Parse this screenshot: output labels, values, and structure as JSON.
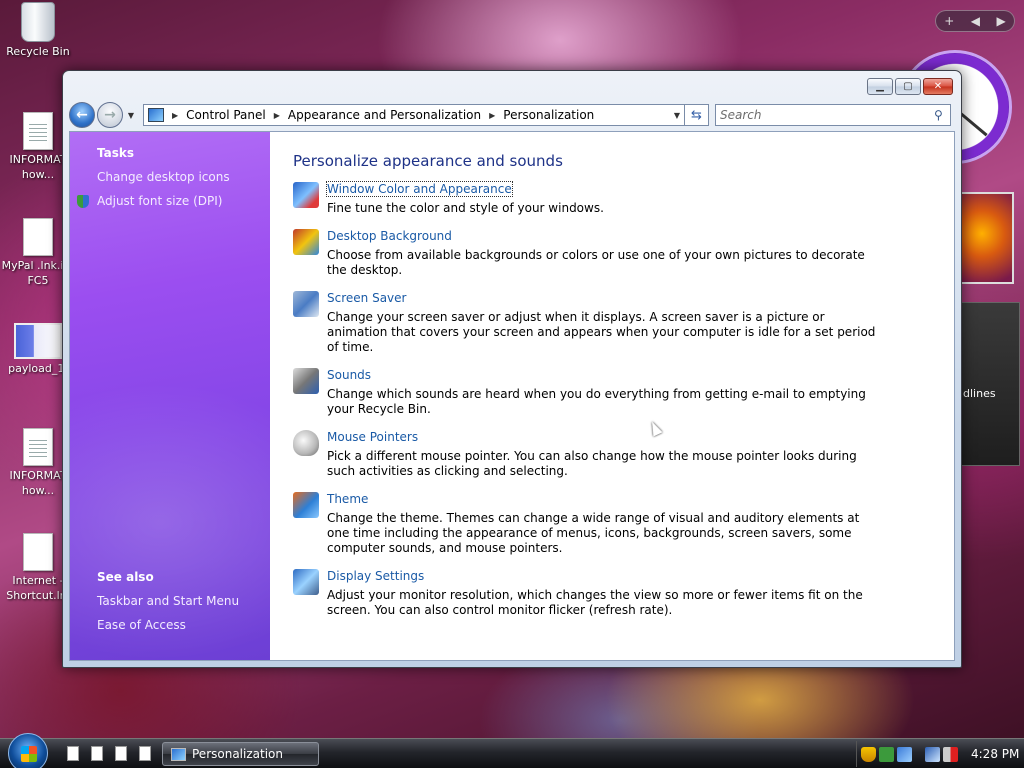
{
  "desktop": {
    "icons": [
      {
        "label": "Recycle Bin"
      },
      {
        "label": "INFORMAT how..."
      },
      {
        "label": "MyPal .lnk.id-FC5"
      },
      {
        "label": "payload_1."
      },
      {
        "label": "INFORMAT how..."
      },
      {
        "label": "Internet - Shortcut.lnl"
      }
    ],
    "gadget_controls": {
      "add": "+",
      "prev": "◀",
      "next": "▶"
    },
    "feed_gadget_text": "dlines"
  },
  "window": {
    "title_buttons": {
      "minimize": "▁",
      "maximize": "▢",
      "close": "✕"
    },
    "breadcrumb": [
      "Control Panel",
      "Appearance and Personalization",
      "Personalization"
    ],
    "search_placeholder": "Search",
    "sidebar": {
      "tasks_heading": "Tasks",
      "tasks": [
        "Change desktop icons",
        "Adjust font size (DPI)"
      ],
      "see_also_heading": "See also",
      "see_also": [
        "Taskbar and Start Menu",
        "Ease of Access"
      ]
    },
    "main": {
      "heading": "Personalize appearance and sounds",
      "items": [
        {
          "icon": "window-color-icon",
          "title": "Window Color and Appearance",
          "desc": "Fine tune the color and style of your windows."
        },
        {
          "icon": "desktop-background-icon",
          "title": "Desktop Background",
          "desc": "Choose from available backgrounds or colors or use one of your own pictures to decorate the desktop."
        },
        {
          "icon": "screen-saver-icon",
          "title": "Screen Saver",
          "desc": "Change your screen saver or adjust when it displays. A screen saver is a picture or animation that covers your screen and appears when your computer is idle for a set period of time."
        },
        {
          "icon": "sounds-icon",
          "title": "Sounds",
          "desc": "Change which sounds are heard when you do everything from getting e-mail to emptying your Recycle Bin."
        },
        {
          "icon": "mouse-pointers-icon",
          "title": "Mouse Pointers",
          "desc": "Pick a different mouse pointer. You can also change how the mouse pointer looks during such activities as clicking and selecting."
        },
        {
          "icon": "theme-icon",
          "title": "Theme",
          "desc": "Change the theme. Themes can change a wide range of visual and auditory elements at one time including the appearance of menus, icons, backgrounds, screen savers, some computer sounds, and mouse pointers."
        },
        {
          "icon": "display-settings-icon",
          "title": "Display Settings",
          "desc": "Adjust your monitor resolution, which changes the view so more or fewer items fit on the screen. You can also control monitor flicker (refresh rate)."
        }
      ]
    }
  },
  "taskbar": {
    "task_button_label": "Personalization",
    "clock": "4:28 PM"
  }
}
